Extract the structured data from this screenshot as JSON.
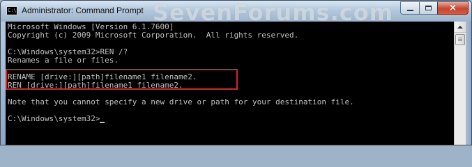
{
  "window": {
    "title": "Administrator: Command Prompt",
    "icon_text": "C:\\",
    "watermark": "SevenForums.com"
  },
  "caption_buttons": {
    "minimize": "minimize-icon",
    "maximize": "maximize-icon",
    "close": "×"
  },
  "console": {
    "lines": [
      "Microsoft Windows [Version 6.1.7600]",
      "Copyright (c) 2009 Microsoft Corporation.  All rights reserved.",
      "",
      "C:\\Windows\\system32>REN /?",
      "Renames a file or files.",
      "",
      "RENAME [drive:][path]filename1 filename2.",
      "REN [drive:][path]filename1 filename2.",
      "",
      "Note that you cannot specify a new drive or path for your destination file.",
      "",
      "C:\\Windows\\system32>"
    ]
  },
  "colors": {
    "console_bg": "#000000",
    "console_text": "#c0c0c0",
    "highlight_border": "#d8232a"
  }
}
